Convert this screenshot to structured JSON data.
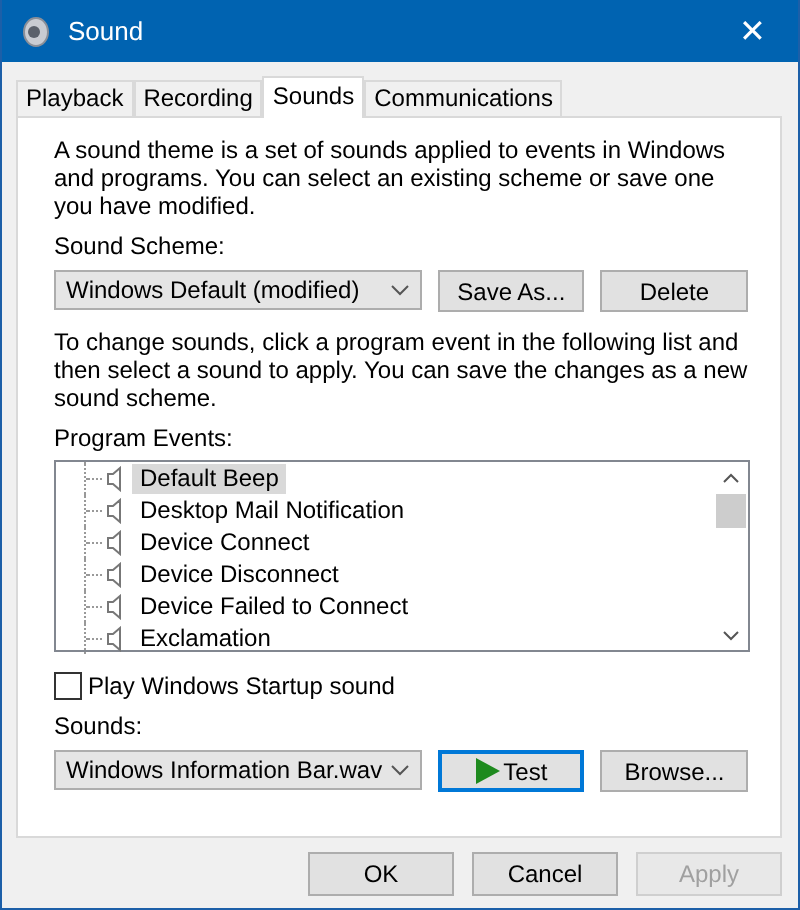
{
  "window": {
    "title": "Sound",
    "close": "✕"
  },
  "tabs": [
    {
      "label": "Playback",
      "selected": false
    },
    {
      "label": "Recording",
      "selected": false
    },
    {
      "label": "Sounds",
      "selected": true
    },
    {
      "label": "Communications",
      "selected": false
    }
  ],
  "intro": "A sound theme is a set of sounds applied to events in Windows and programs.  You can select an existing scheme or save one you have modified.",
  "scheme": {
    "label": "Sound Scheme:",
    "value": "Windows Default (modified)",
    "buttons": [
      "Save As...",
      "Delete"
    ]
  },
  "instructions": "To change sounds, click a program event in the following list and then select a sound to apply.  You can save the changes as a new sound scheme.",
  "events": {
    "label": "Program Events:",
    "items": [
      {
        "name": "Default Beep",
        "selected": true
      },
      {
        "name": "Desktop Mail Notification",
        "selected": false
      },
      {
        "name": "Device Connect",
        "selected": false
      },
      {
        "name": "Device Disconnect",
        "selected": false
      },
      {
        "name": "Device Failed to Connect",
        "selected": false
      },
      {
        "name": "Exclamation",
        "selected": false
      }
    ]
  },
  "startup": {
    "label": "Play Windows Startup sound",
    "checked": false
  },
  "sounds": {
    "label": "Sounds:",
    "value": "Windows Information Bar.wav",
    "test": "Test",
    "browse": "Browse..."
  },
  "buttons": [
    {
      "label": "OK",
      "disabled": false
    },
    {
      "label": "Cancel",
      "disabled": false
    },
    {
      "label": "Apply",
      "disabled": true
    }
  ]
}
